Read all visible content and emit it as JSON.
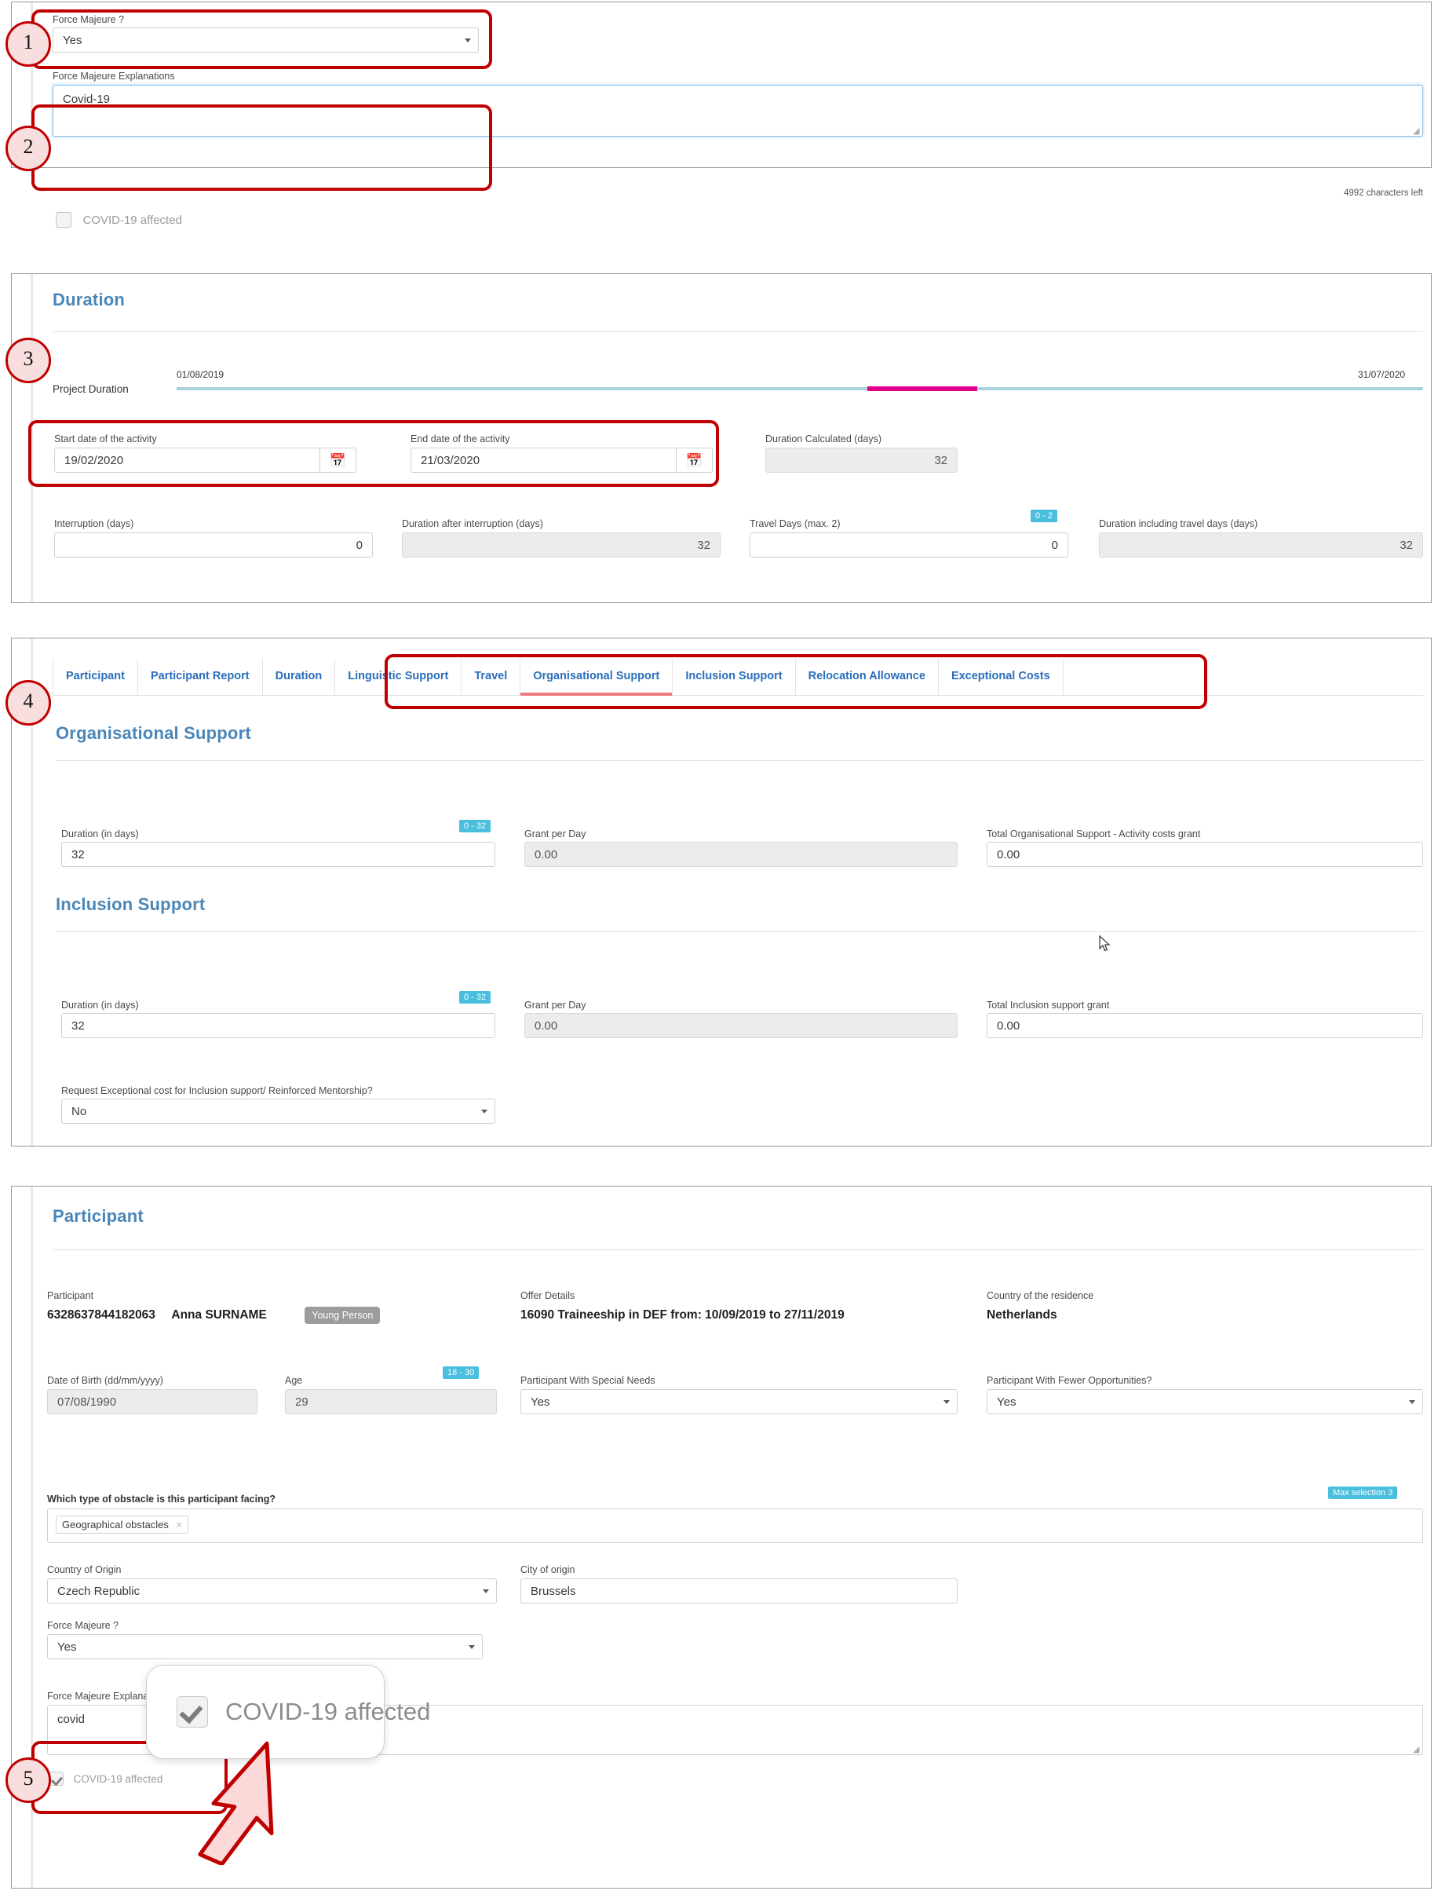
{
  "section_force_majeure_top": {
    "force_majeure_label": "Force Majeure ?",
    "force_majeure_value": "Yes",
    "explanations_label": "Force Majeure Explanations",
    "explanations_value": "Covid-19",
    "chars_left": "4992 characters left",
    "covid_checkbox_label": "COVID-19 affected"
  },
  "duration": {
    "title": "Duration",
    "project_duration_label": "Project Duration",
    "project_start": "01/08/2019",
    "project_end": "31/07/2020",
    "start_date_label": "Start date of the activity",
    "start_date_value": "19/02/2020",
    "end_date_label": "End date of the activity",
    "end_date_value": "21/03/2020",
    "duration_calculated_label": "Duration Calculated (days)",
    "duration_calculated_value": "32",
    "interruption_label": "Interruption (days)",
    "interruption_value": "0",
    "duration_after_interruption_label": "Duration after interruption (days)",
    "duration_after_interruption_value": "32",
    "travel_days_label": "Travel Days (max. 2)",
    "travel_days_badge": "0 - 2",
    "travel_days_value": "0",
    "duration_incl_travel_label": "Duration including travel days (days)",
    "duration_incl_travel_value": "32"
  },
  "tabs": [
    {
      "label": "Participant",
      "active": false
    },
    {
      "label": "Participant Report",
      "active": false
    },
    {
      "label": "Duration",
      "active": false
    },
    {
      "label": "Linguistic Support",
      "active": false
    },
    {
      "label": "Travel",
      "active": false
    },
    {
      "label": "Organisational Support",
      "active": true
    },
    {
      "label": "Inclusion Support",
      "active": false
    },
    {
      "label": "Relocation Allowance",
      "active": false
    },
    {
      "label": "Exceptional Costs",
      "active": false
    }
  ],
  "organisational_support": {
    "title": "Organisational Support",
    "duration_label": "Duration (in days)",
    "duration_badge": "0 - 32",
    "duration_value": "32",
    "grant_per_day_label": "Grant per Day",
    "grant_per_day_value": "0.00",
    "total_label": "Total Organisational Support - Activity costs grant",
    "total_value": "0.00"
  },
  "inclusion_support": {
    "title": "Inclusion Support",
    "duration_label": "Duration (in days)",
    "duration_badge": "0 - 32",
    "duration_value": "32",
    "grant_per_day_label": "Grant per Day",
    "grant_per_day_value": "0.00",
    "total_label": "Total Inclusion support grant",
    "total_value": "0.00",
    "request_exceptional_label": "Request Exceptional cost for Inclusion support/ Reinforced Mentorship?",
    "request_exceptional_value": "No"
  },
  "participant": {
    "title": "Participant",
    "participant_label": "Participant",
    "participant_id": "6328637844182063",
    "participant_name": "Anna SURNAME",
    "participant_tag": "Young Person",
    "offer_details_label": "Offer Details",
    "offer_details_value": "16090 Traineeship in DEF from: 10/09/2019 to 27/11/2019",
    "country_residence_label": "Country of the residence",
    "country_residence_value": "Netherlands",
    "dob_label": "Date of Birth (dd/mm/yyyy)",
    "dob_value": "07/08/1990",
    "age_label": "Age",
    "age_badge": "18 - 30",
    "age_value": "29",
    "special_needs_label": "Participant With Special Needs",
    "special_needs_value": "Yes",
    "fewer_opportunities_label": "Participant With Fewer Opportunities?",
    "fewer_opportunities_value": "Yes",
    "obstacle_label": "Which type of obstacle is this participant facing?",
    "obstacle_badge": "Max selection 3",
    "obstacle_chip": "Geographical obstacles",
    "obstacle_chip_remove": "×",
    "country_origin_label": "Country of Origin",
    "country_origin_value": "Czech Republic",
    "city_origin_label": "City of origin",
    "city_origin_value": "Brussels",
    "force_majeure_label": "Force Majeure ?",
    "force_majeure_value": "Yes",
    "explanations_label": "Force Majeure Explanations",
    "explanations_value": "covid",
    "covid_checkbox_label": "COVID-19 affected"
  },
  "zoom_bubble": {
    "label": "COVID-19 affected"
  },
  "annotations": {
    "markers": [
      "1",
      "2",
      "3",
      "4",
      "5"
    ]
  },
  "colors": {
    "accent_blue": "#4a86b8",
    "tab_blue": "#2a6ebb",
    "badge_cyan": "#49bedd",
    "annotation_red": "#c00000",
    "timeline_base": "#a8d3dd",
    "timeline_segment": "#e3008c",
    "active_tab_underline": "#ef7b7b"
  }
}
